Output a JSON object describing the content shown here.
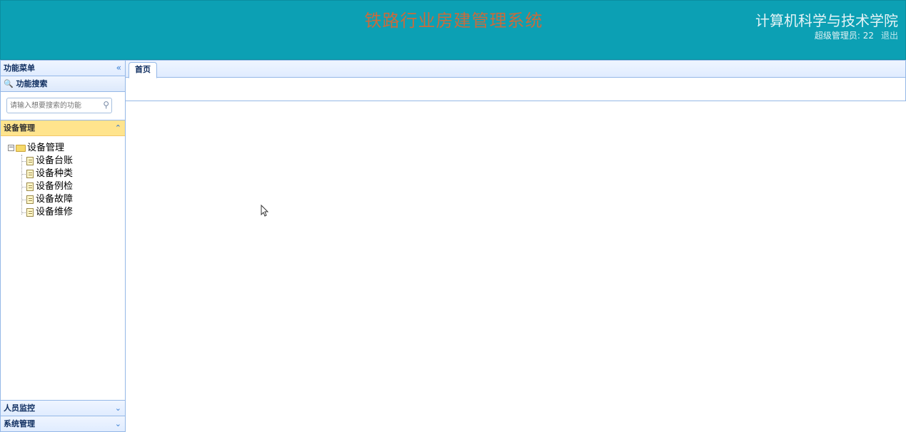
{
  "header": {
    "title": "铁路行业房建管理系统",
    "college": "计算机科学与技术学院",
    "user_label": "超级管理员: 22",
    "logout": "退出"
  },
  "sidebar": {
    "menu_title": "功能菜单",
    "collapse_icon": "double-chevron-left-icon",
    "search_title": "功能搜索",
    "search_placeholder": "请输入想要搜索的功能",
    "sections": [
      {
        "label": "设备管理",
        "expanded": true,
        "tree": {
          "root": "设备管理",
          "children": [
            "设备台账",
            "设备种类",
            "设备例检",
            "设备故障",
            "设备维修"
          ]
        }
      },
      {
        "label": "人员监控",
        "expanded": false
      },
      {
        "label": "系统管理",
        "expanded": false
      }
    ]
  },
  "tabs": [
    {
      "label": "首页",
      "active": true
    }
  ],
  "colors": {
    "header_bg": "#0ca0b4",
    "title": "#c96b3c",
    "panel_border": "#95b8e7",
    "active_accordion": "#ffe48d"
  }
}
